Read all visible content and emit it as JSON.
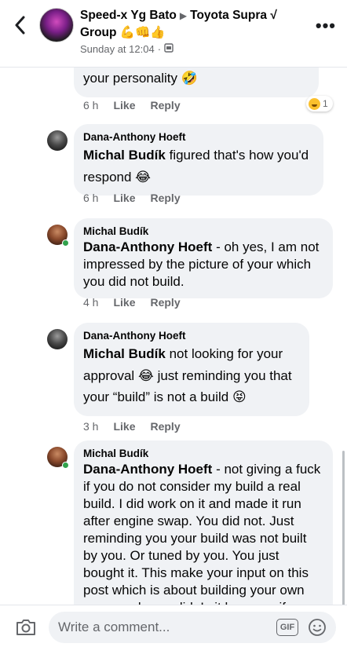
{
  "header": {
    "author": "Speed-x Yg Bato",
    "group_line1": "Toyota Supra",
    "group_tick": "√",
    "group_line2": "Group",
    "group_emoji": "💪👊👍",
    "timestamp": "Sunday at 12:04",
    "separator": "·"
  },
  "comments": [
    {
      "text": "your personality",
      "emoji": "🤣",
      "time": "6 h",
      "like_label": "Like",
      "reply_label": "Reply",
      "reaction_count": "1"
    },
    {
      "author": "Dana-Anthony Hoeft",
      "tag": "Michal Budík",
      "text": "figured that's how you'd respond",
      "emoji": "😂",
      "time": "6 h",
      "like_label": "Like",
      "reply_label": "Reply"
    },
    {
      "author": "Michal Budík",
      "tag": "Dana-Anthony Hoeft",
      "text": "- oh yes, I am not impressed by the picture of your which you did not build.",
      "time": "4 h",
      "like_label": "Like",
      "reply_label": "Reply"
    },
    {
      "author": "Dana-Anthony Hoeft",
      "tag": "Michal Budík",
      "text_a": "not looking for your approval",
      "emoji_a": "😂",
      "text_b": "just reminding you that your “build” is not a build",
      "emoji_b": "😝",
      "time": "3 h",
      "like_label": "Like",
      "reply_label": "Reply"
    },
    {
      "author": "Michal Budík",
      "tag": "Dana-Anthony Hoeft",
      "text": "- not giving a fuck if you do not consider my build a real build. I did work on it and made it run after engine swap. You did not. Just reminding you your build was not built by you. Or tuned by you. You just bought it. This make your input on this post which is about building your own car even less valid. Is it because if you"
    }
  ],
  "composer": {
    "placeholder": "Write a comment...",
    "gif_label": "GIF"
  },
  "colors": {
    "bubble": "#f0f2f5",
    "online": "#31a24c",
    "muted": "#65676b"
  }
}
